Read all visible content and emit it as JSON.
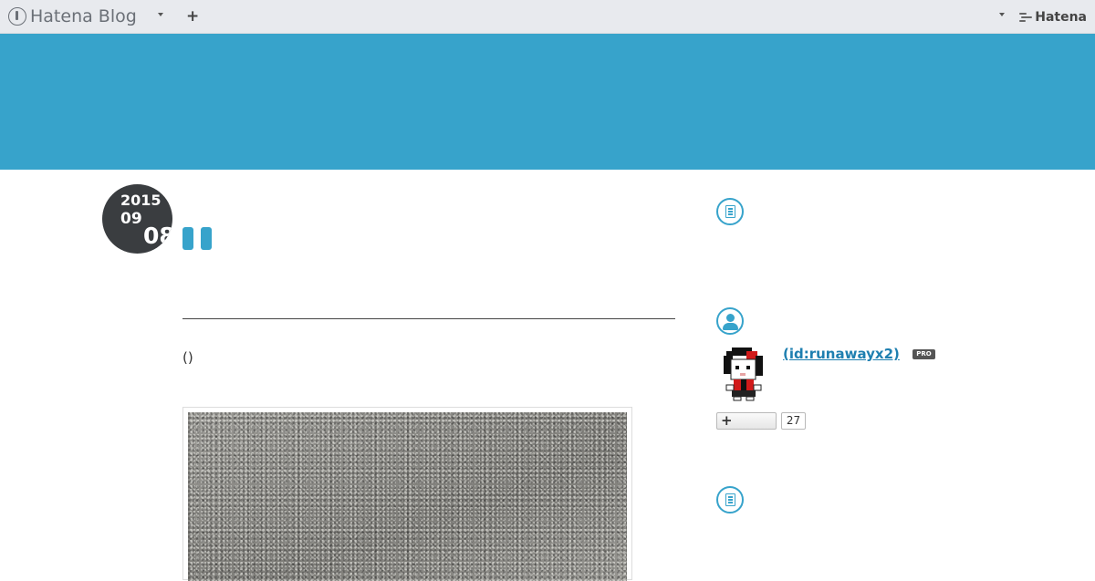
{
  "header": {
    "logo_text": "Hatena Blog",
    "add_label": "+",
    "brand_text": "Hatena"
  },
  "entry": {
    "date": {
      "year": "2015",
      "month": "09",
      "day": "08"
    },
    "body_text": "()"
  },
  "sidebar": {
    "profile": {
      "id_label": " (id:runawayx2)",
      "pro_badge": "PRO",
      "follow_plus": "+",
      "follower_count": "27"
    }
  },
  "colors": {
    "accent": "#37a3cb",
    "header_bg": "#e8eaee",
    "date_badge": "#3a3d40"
  },
  "icons": [
    "hatena-blog-logo-icon",
    "chevron-down-icon",
    "plus-icon",
    "hatena-brand-icon",
    "document-icon",
    "user-icon"
  ]
}
